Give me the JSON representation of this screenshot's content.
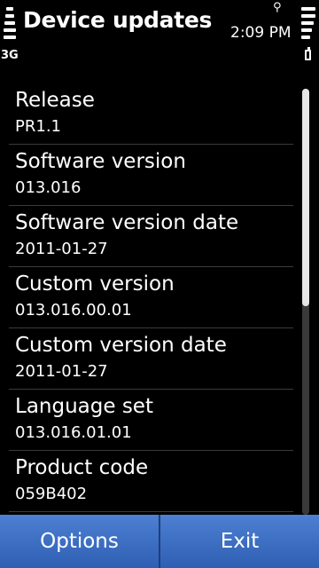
{
  "status": {
    "title": "Device updates",
    "network_type": "3G",
    "clock": "2:09 PM",
    "net_icon": "Ẏ "
  },
  "items": [
    {
      "label": "Release",
      "value": "PR1.1"
    },
    {
      "label": "Software version",
      "value": "013.016"
    },
    {
      "label": "Software version date",
      "value": "2011-01-27"
    },
    {
      "label": "Custom version",
      "value": "013.016.00.01"
    },
    {
      "label": "Custom version date",
      "value": "2011-01-27"
    },
    {
      "label": "Language set",
      "value": "013.016.01.01"
    },
    {
      "label": "Product code",
      "value": "059B402"
    }
  ],
  "softkeys": {
    "left": "Options",
    "right": "Exit"
  },
  "scrollbar": {
    "visible_fraction": 0.51
  }
}
